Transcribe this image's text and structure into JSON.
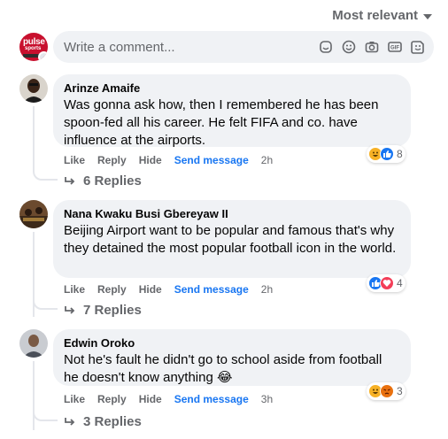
{
  "sort": {
    "label": "Most relevant"
  },
  "composer": {
    "placeholder": "Write a comment...",
    "avatar": {
      "line1": "pulse",
      "line2": "sports"
    },
    "icons": [
      "sticker-icon",
      "emoji-icon",
      "camera-icon",
      "gif-icon",
      "avatar-sticker-icon"
    ]
  },
  "comments": [
    {
      "author": "Arinze Amaife",
      "text": "Was gonna ask how, then I remembered he has been spoon-fed all his career. He felt FIFA and co. have influence at the airports.",
      "actions": {
        "like": "Like",
        "reply": "Reply",
        "hide": "Hide",
        "send": "Send message",
        "time": "2h"
      },
      "reactions": {
        "icons": [
          "haha",
          "like"
        ],
        "count": "8"
      },
      "replies": "6 Replies"
    },
    {
      "author": "Nana Kwaku Busi Gbereyaw II",
      "text": "Beijing Airport want to be popular and famous that's why they detained the most popular football icon in the world.",
      "actions": {
        "like": "Like",
        "reply": "Reply",
        "hide": "Hide",
        "send": "Send message",
        "time": "2h"
      },
      "reactions": {
        "icons": [
          "like",
          "love"
        ],
        "count": "4"
      },
      "replies": "7 Replies"
    },
    {
      "author": "Edwin Oroko",
      "text": "Not he's fault he didn't go to school aside from football he doesn't know anything 😂",
      "actions": {
        "like": "Like",
        "reply": "Reply",
        "hide": "Hide",
        "send": "Send message",
        "time": "3h"
      },
      "reactions": {
        "icons": [
          "haha",
          "angry"
        ],
        "count": "3"
      },
      "replies": "3 Replies"
    }
  ],
  "colors": {
    "like": "#1876f2",
    "love": "#f33e58",
    "haha": "#f7b125",
    "angry": "#e9710f",
    "link": "#1876f2",
    "bubble": "#f0f2f5"
  }
}
